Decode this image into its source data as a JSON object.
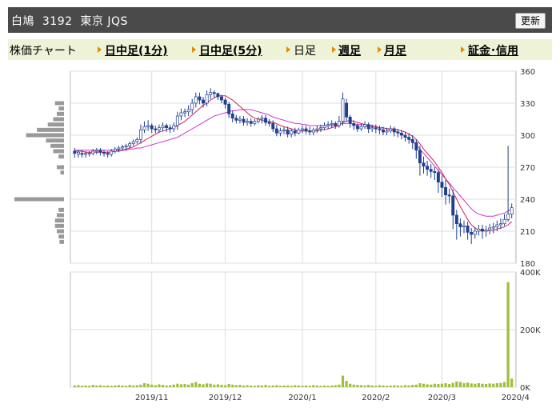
{
  "header": {
    "title": "白鳩  3192  東京 JQS",
    "refresh_label": "更新"
  },
  "nav": {
    "items": [
      {
        "label": "株価チャート",
        "bold": false,
        "arrow": false
      },
      {
        "label": "日中足(1分)",
        "bold": true,
        "arrow": true
      },
      {
        "label": "日中足(5分)",
        "bold": true,
        "arrow": true
      },
      {
        "label": "日足",
        "bold": false,
        "arrow": true
      },
      {
        "label": "週足",
        "bold": true,
        "arrow": true
      },
      {
        "label": "月足",
        "bold": true,
        "arrow": true
      },
      {
        "label": "証金･信用",
        "bold": true,
        "arrow": true
      }
    ]
  },
  "colors": {
    "header_bg": "#4a4a4a",
    "nav_bg": "#eef2d6",
    "candle_up": "#ffffff",
    "candle_down": "#1f3f8f",
    "ma_short": "#cc2255",
    "ma_long": "#cc33cc",
    "volume": "#9fbf3a",
    "volume_profile": "#999999"
  },
  "chart_data": [
    {
      "type": "candlestick",
      "ylim": [
        180,
        360
      ],
      "yticks": [
        180,
        210,
        240,
        270,
        300,
        330,
        360
      ],
      "x_tick_labels": [
        "2019/11",
        "2019/12",
        "2020/1",
        "2020/2",
        "2020/3",
        "2020/4"
      ],
      "x_tick_index": [
        21,
        41,
        62,
        82,
        100,
        120
      ],
      "close": [
        283,
        284,
        282,
        283,
        283,
        285,
        286,
        284,
        283,
        282,
        285,
        287,
        288,
        289,
        290,
        292,
        294,
        296,
        305,
        308,
        309,
        306,
        305,
        307,
        309,
        307,
        306,
        309,
        318,
        321,
        322,
        324,
        330,
        336,
        333,
        330,
        338,
        340,
        339,
        336,
        333,
        329,
        320,
        316,
        314,
        315,
        312,
        313,
        311,
        313,
        315,
        316,
        312,
        311,
        306,
        302,
        304,
        305,
        301,
        304,
        302,
        305,
        306,
        304,
        303,
        305,
        306,
        307,
        309,
        310,
        311,
        309,
        313,
        334,
        317,
        311,
        309,
        306,
        308,
        310,
        306,
        307,
        306,
        305,
        303,
        304,
        306,
        303,
        302,
        300,
        298,
        296,
        293,
        286,
        274,
        271,
        268,
        266,
        265,
        256,
        251,
        244,
        243,
        225,
        217,
        214,
        215,
        209,
        207,
        210,
        212,
        210,
        211,
        213,
        214,
        216,
        217,
        221,
        226,
        232
      ],
      "open": [
        285,
        282,
        283,
        282,
        283,
        283,
        285,
        286,
        284,
        283,
        282,
        285,
        287,
        288,
        289,
        290,
        292,
        294,
        296,
        305,
        308,
        309,
        306,
        305,
        307,
        309,
        307,
        306,
        309,
        318,
        321,
        322,
        324,
        330,
        336,
        333,
        330,
        338,
        340,
        339,
        336,
        333,
        329,
        320,
        316,
        314,
        315,
        312,
        313,
        311,
        313,
        315,
        316,
        312,
        311,
        306,
        302,
        304,
        305,
        301,
        304,
        302,
        305,
        306,
        304,
        303,
        305,
        306,
        307,
        309,
        310,
        311,
        309,
        313,
        330,
        317,
        311,
        309,
        306,
        308,
        310,
        306,
        307,
        306,
        305,
        303,
        304,
        306,
        303,
        302,
        300,
        298,
        296,
        293,
        286,
        274,
        271,
        268,
        266,
        265,
        256,
        251,
        244,
        243,
        225,
        217,
        214,
        215,
        209,
        207,
        210,
        212,
        210,
        211,
        213,
        214,
        216,
        217,
        221,
        226
      ],
      "high": [
        288,
        286,
        286,
        285,
        285,
        287,
        288,
        288,
        286,
        285,
        287,
        289,
        290,
        291,
        292,
        294,
        296,
        298,
        310,
        313,
        314,
        311,
        309,
        310,
        312,
        311,
        310,
        312,
        322,
        325,
        325,
        328,
        334,
        340,
        340,
        336,
        342,
        344,
        342,
        340,
        338,
        335,
        331,
        323,
        319,
        318,
        318,
        316,
        316,
        315,
        317,
        319,
        319,
        315,
        314,
        310,
        307,
        308,
        308,
        306,
        307,
        307,
        309,
        309,
        308,
        307,
        309,
        310,
        312,
        313,
        314,
        313,
        318,
        340,
        334,
        319,
        314,
        311,
        311,
        313,
        312,
        310,
        310,
        309,
        308,
        307,
        309,
        308,
        306,
        305,
        303,
        302,
        300,
        296,
        290,
        280,
        276,
        273,
        270,
        268,
        262,
        258,
        250,
        249,
        230,
        222,
        220,
        219,
        213,
        214,
        216,
        216,
        215,
        217,
        218,
        220,
        222,
        226,
        290,
        236
      ],
      "low": [
        279,
        279,
        279,
        279,
        280,
        281,
        282,
        281,
        280,
        279,
        280,
        283,
        284,
        285,
        286,
        288,
        290,
        292,
        292,
        302,
        304,
        302,
        302,
        302,
        304,
        303,
        302,
        303,
        305,
        314,
        317,
        318,
        320,
        326,
        329,
        326,
        327,
        334,
        335,
        333,
        330,
        325,
        316,
        312,
        311,
        311,
        309,
        309,
        308,
        309,
        311,
        311,
        309,
        308,
        303,
        299,
        299,
        301,
        298,
        298,
        299,
        301,
        302,
        301,
        300,
        300,
        302,
        303,
        305,
        306,
        307,
        306,
        307,
        309,
        313,
        307,
        305,
        303,
        304,
        306,
        302,
        303,
        302,
        301,
        300,
        300,
        302,
        299,
        298,
        296,
        294,
        292,
        287,
        278,
        262,
        264,
        262,
        260,
        258,
        246,
        242,
        235,
        236,
        212,
        202,
        205,
        208,
        202,
        198,
        203,
        206,
        203,
        205,
        207,
        208,
        210,
        212,
        215,
        219,
        222
      ],
      "ma_short": [
        285,
        285,
        285,
        284,
        284,
        284,
        284,
        284,
        284,
        284,
        284,
        285,
        285,
        286,
        287,
        288,
        289,
        291,
        293,
        295,
        297,
        299,
        301,
        303,
        304,
        305,
        306,
        307,
        309,
        311,
        313,
        316,
        319,
        322,
        325,
        328,
        330,
        333,
        335,
        337,
        337,
        337,
        335,
        333,
        330,
        327,
        324,
        321,
        318,
        316,
        315,
        314,
        313,
        313,
        312,
        311,
        309,
        308,
        307,
        306,
        305,
        304,
        304,
        304,
        304,
        304,
        304,
        305,
        305,
        306,
        307,
        308,
        309,
        312,
        313,
        314,
        313,
        312,
        311,
        310,
        309,
        309,
        308,
        307,
        307,
        306,
        306,
        306,
        305,
        304,
        303,
        301,
        299,
        296,
        292,
        287,
        283,
        279,
        275,
        270,
        265,
        259,
        254,
        247,
        240,
        233,
        227,
        221,
        216,
        213,
        211,
        211,
        210,
        211,
        211,
        212,
        213,
        214,
        216,
        219
      ],
      "ma_long": [
        286,
        286,
        286,
        286,
        286,
        286,
        286,
        286,
        286,
        286,
        286,
        286,
        286,
        286,
        286,
        287,
        287,
        288,
        288,
        289,
        290,
        291,
        292,
        293,
        294,
        295,
        296,
        297,
        298,
        300,
        302,
        304,
        306,
        308,
        310,
        312,
        314,
        316,
        318,
        319,
        320,
        321,
        322,
        323,
        323,
        324,
        324,
        324,
        324,
        323,
        322,
        321,
        320,
        319,
        317,
        316,
        315,
        314,
        313,
        312,
        311,
        311,
        310,
        310,
        309,
        309,
        309,
        309,
        309,
        309,
        309,
        309,
        310,
        311,
        311,
        311,
        310,
        310,
        310,
        309,
        309,
        308,
        308,
        307,
        307,
        306,
        305,
        304,
        303,
        301,
        299,
        297,
        294,
        291,
        287,
        283,
        279,
        275,
        271,
        267,
        263,
        259,
        255,
        251,
        247,
        243,
        239,
        235,
        231,
        228,
        226,
        225,
        224,
        224,
        224,
        225,
        226,
        227,
        229,
        231
      ],
      "volume_profile": [
        {
          "price": 330,
          "size": 0.1
        },
        {
          "price": 325,
          "size": 0.06
        },
        {
          "price": 320,
          "size": 0.08
        },
        {
          "price": 315,
          "size": 0.12
        },
        {
          "price": 310,
          "size": 0.18
        },
        {
          "price": 305,
          "size": 0.3
        },
        {
          "price": 300,
          "size": 0.42
        },
        {
          "price": 295,
          "size": 0.2
        },
        {
          "price": 290,
          "size": 0.15
        },
        {
          "price": 285,
          "size": 0.12
        },
        {
          "price": 280,
          "size": 0.06
        },
        {
          "price": 270,
          "size": 0.08
        },
        {
          "price": 265,
          "size": 0.04
        },
        {
          "price": 240,
          "size": 0.55
        },
        {
          "price": 230,
          "size": 0.06
        },
        {
          "price": 225,
          "size": 0.08
        },
        {
          "price": 220,
          "size": 0.1
        },
        {
          "price": 215,
          "size": 0.1
        },
        {
          "price": 210,
          "size": 0.08
        },
        {
          "price": 205,
          "size": 0.06
        },
        {
          "price": 200,
          "size": 0.05
        }
      ]
    },
    {
      "type": "bar",
      "ylim": [
        0,
        400000
      ],
      "ytick_labels": [
        "0K",
        "200K",
        "400K"
      ],
      "yticks": [
        0,
        200000,
        400000
      ],
      "values": [
        6000,
        7000,
        5000,
        6000,
        5000,
        8000,
        6000,
        7000,
        5000,
        6000,
        5000,
        6000,
        7000,
        6000,
        5000,
        8000,
        6000,
        7000,
        9000,
        14000,
        12000,
        9000,
        7000,
        10000,
        8000,
        6000,
        7000,
        9000,
        12000,
        10000,
        11000,
        9000,
        14000,
        18000,
        12000,
        10000,
        13000,
        12000,
        9000,
        10000,
        8000,
        7000,
        11000,
        9000,
        7000,
        8000,
        6000,
        7000,
        6000,
        5000,
        7000,
        6000,
        8000,
        5000,
        6000,
        7000,
        5000,
        6000,
        6000,
        5000,
        7000,
        6000,
        5000,
        6000,
        5000,
        7000,
        6000,
        5000,
        6000,
        5000,
        6000,
        7000,
        9000,
        40000,
        22000,
        12000,
        9000,
        8000,
        7000,
        6000,
        8000,
        6000,
        5000,
        7000,
        6000,
        5000,
        6000,
        7000,
        6000,
        5000,
        7000,
        6000,
        8000,
        9000,
        14000,
        12000,
        10000,
        9000,
        12000,
        11000,
        12000,
        14000,
        11000,
        15000,
        20000,
        18000,
        14000,
        16000,
        13000,
        12000,
        14000,
        12000,
        11000,
        13000,
        12000,
        14000,
        15000,
        18000,
        365000,
        30000
      ]
    }
  ]
}
